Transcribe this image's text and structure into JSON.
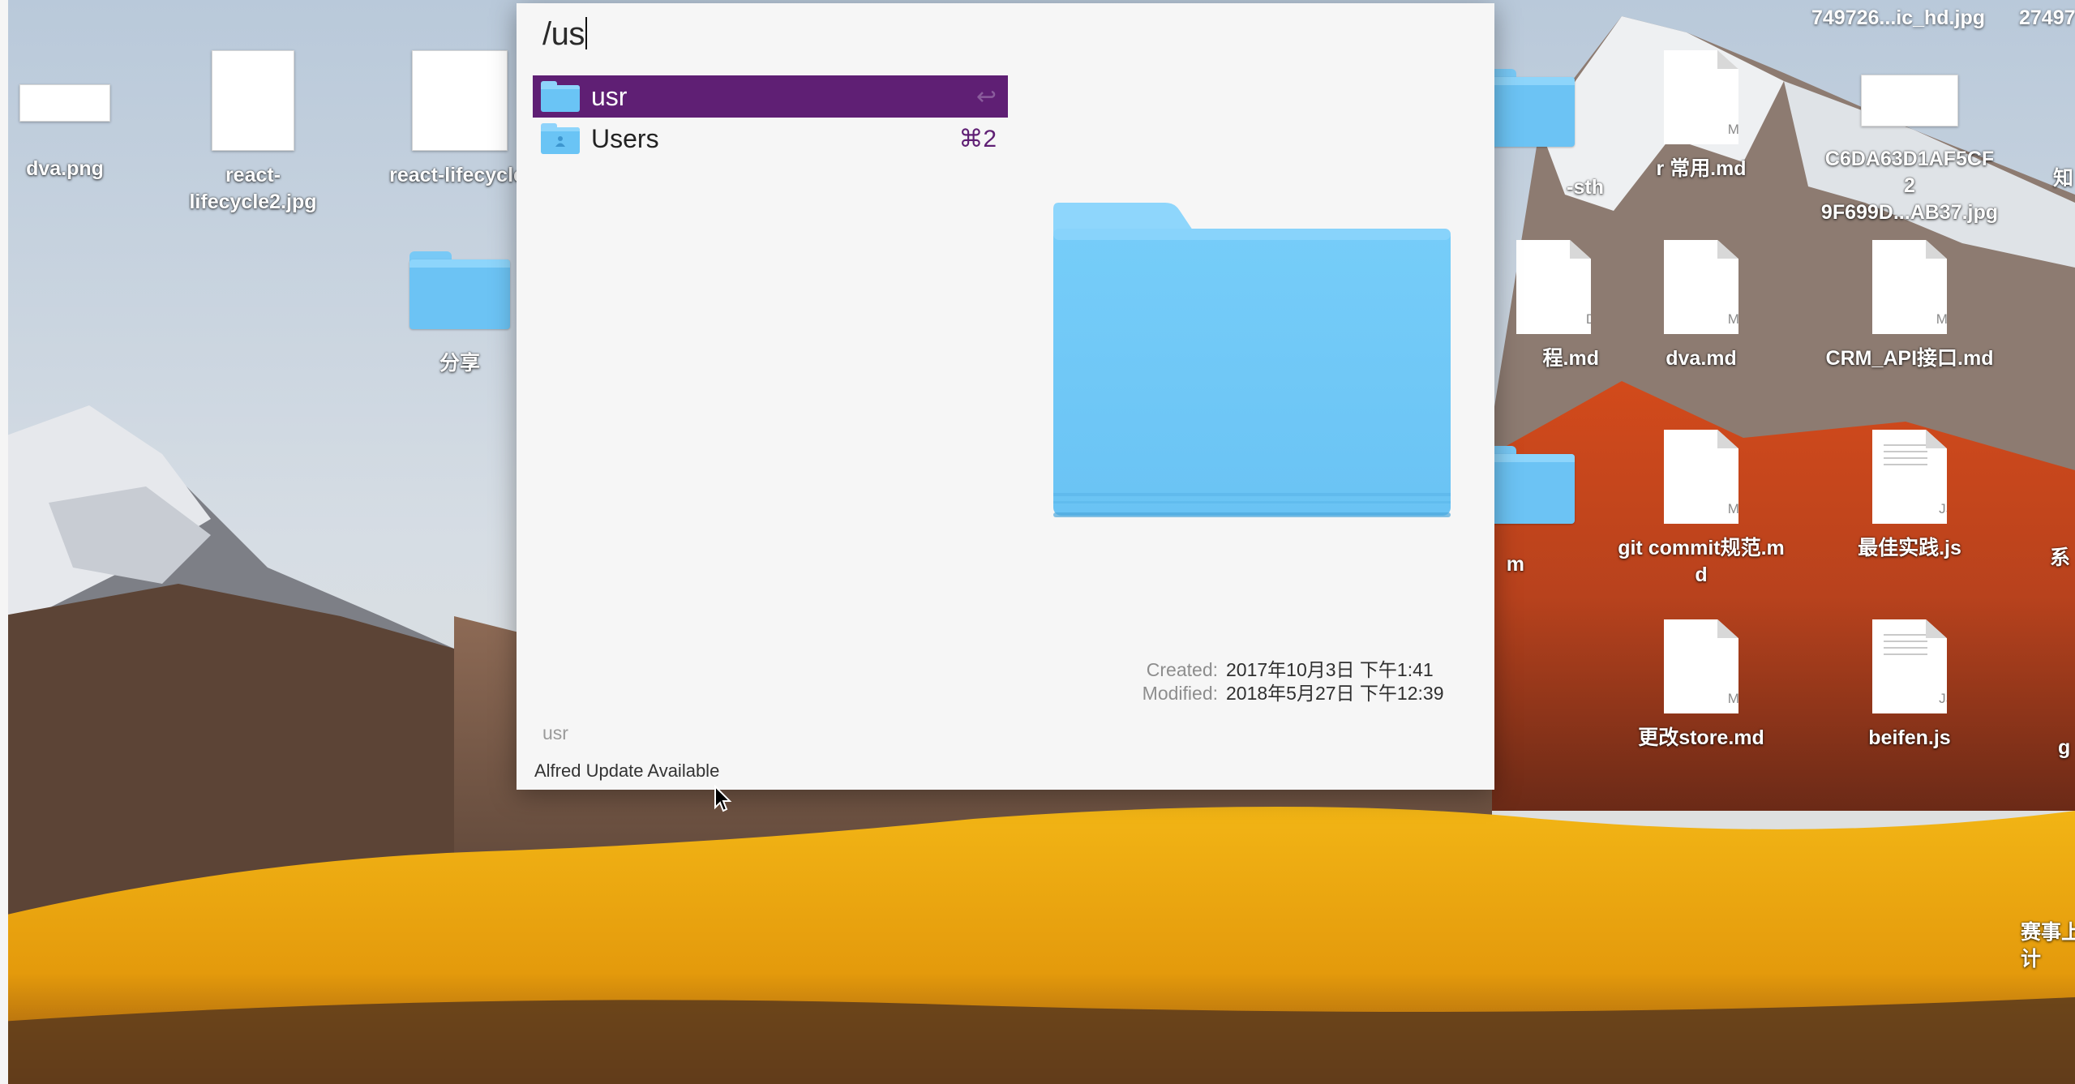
{
  "alfred": {
    "query": "/us",
    "results": [
      {
        "name": "usr",
        "shortcut": "↩",
        "selected": true
      },
      {
        "name": "Users",
        "shortcut": "⌘2",
        "selected": false
      }
    ],
    "details": {
      "created_label": "Created:",
      "created_value": "2017年10月3日 下午1:41",
      "modified_label": "Modified:",
      "modified_value": "2018年5月27日 下午12:39"
    },
    "subtitle": "usr",
    "update_notice": "Alfred Update Available",
    "accent_color": "#5f1f74"
  },
  "desktop": {
    "top_files": [
      "749726...ic_hd.jpg",
      "27497"
    ],
    "icons": [
      {
        "label": "dva.png",
        "kind": "image"
      },
      {
        "label": "react-\nlifecycle2.jpg",
        "kind": "image"
      },
      {
        "label": "react-lifecycle.",
        "kind": "image"
      },
      {
        "label": "分享",
        "kind": "folder"
      },
      {
        "label": "-sth",
        "kind": "folder"
      },
      {
        "label": "r 常用.md",
        "kind": "md",
        "ext": "MD"
      },
      {
        "label": "C6DA63D1AF5CF2\n9F699D...AB37.jpg",
        "kind": "image"
      },
      {
        "label": "知",
        "kind": "partial"
      },
      {
        "label": "程.md",
        "kind": "md",
        "ext": "D"
      },
      {
        "label": "dva.md",
        "kind": "md",
        "ext": "MD"
      },
      {
        "label": "CRM_API接口.md",
        "kind": "md",
        "ext": "MD"
      },
      {
        "label": "m",
        "kind": "folder"
      },
      {
        "label": "git commit规范.md",
        "kind": "md",
        "ext": "MD"
      },
      {
        "label": "最佳实践.js",
        "kind": "js",
        "ext": "JS"
      },
      {
        "label": "系",
        "kind": "partial"
      },
      {
        "label": "更改store.md",
        "kind": "md",
        "ext": "MD"
      },
      {
        "label": "beifen.js",
        "kind": "js",
        "ext": "JS"
      },
      {
        "label": "g",
        "kind": "partial"
      },
      {
        "label": "赛事上\n计",
        "kind": "partial"
      }
    ]
  }
}
